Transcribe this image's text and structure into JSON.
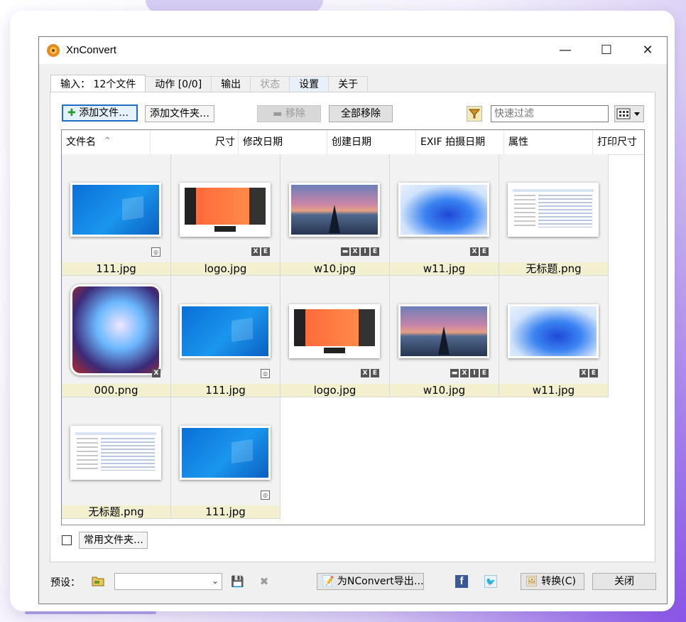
{
  "window": {
    "title": "XnConvert",
    "minimize": "—",
    "maximize": "☐",
    "close": "✕"
  },
  "tabs": [
    {
      "label": "输入： 12个文件",
      "state": "active"
    },
    {
      "label": "动作 [0/0]",
      "state": "normal"
    },
    {
      "label": "输出",
      "state": "normal"
    },
    {
      "label": "状态",
      "state": "disabled"
    },
    {
      "label": "设置",
      "state": "highlight"
    },
    {
      "label": "关于",
      "state": "normal"
    }
  ],
  "toolbar": {
    "add_files": "添加文件…",
    "add_folder": "添加文件夹…",
    "remove": "移除",
    "remove_all": "全部移除",
    "filter_placeholder": "快速过滤"
  },
  "columns": [
    "文件名",
    "尺寸",
    "修改日期",
    "创建日期",
    "EXIF 拍摄日期",
    "属性",
    "打印尺寸"
  ],
  "files": [
    {
      "name": "111.jpg",
      "thumb": "win10",
      "badges": [
        "◎"
      ]
    },
    {
      "name": "logo.jpg",
      "thumb": "logo",
      "badges": [
        "X",
        "E"
      ]
    },
    {
      "name": "w10.jpg",
      "thumb": "pier",
      "badges": [
        "▬",
        "X",
        "I",
        "E"
      ]
    },
    {
      "name": "w11.jpg",
      "thumb": "win11",
      "badges": [
        "X",
        "E"
      ]
    },
    {
      "name": "无标题.png",
      "thumb": "shot",
      "badges": []
    },
    {
      "name": "000.png",
      "thumb": "game",
      "badges": [
        "X"
      ]
    },
    {
      "name": "111.jpg",
      "thumb": "win10",
      "badges": [
        "◎"
      ]
    },
    {
      "name": "logo.jpg",
      "thumb": "logo",
      "badges": [
        "X",
        "E"
      ]
    },
    {
      "name": "w10.jpg",
      "thumb": "pier",
      "badges": [
        "▬",
        "X",
        "I",
        "E"
      ]
    },
    {
      "name": "w11.jpg",
      "thumb": "win11",
      "badges": [
        "X",
        "E"
      ]
    },
    {
      "name": "无标题.png",
      "thumb": "shot",
      "badges": []
    },
    {
      "name": "111.jpg",
      "thumb": "win10",
      "badges": [
        "◎"
      ]
    }
  ],
  "common_folder": {
    "label": "常用文件夹…",
    "checked": false
  },
  "footer": {
    "preset_label": "预设：",
    "preset_value": "",
    "export_label": "为NConvert导出…",
    "convert_label": "转换(C)",
    "close_label": "关闭"
  }
}
